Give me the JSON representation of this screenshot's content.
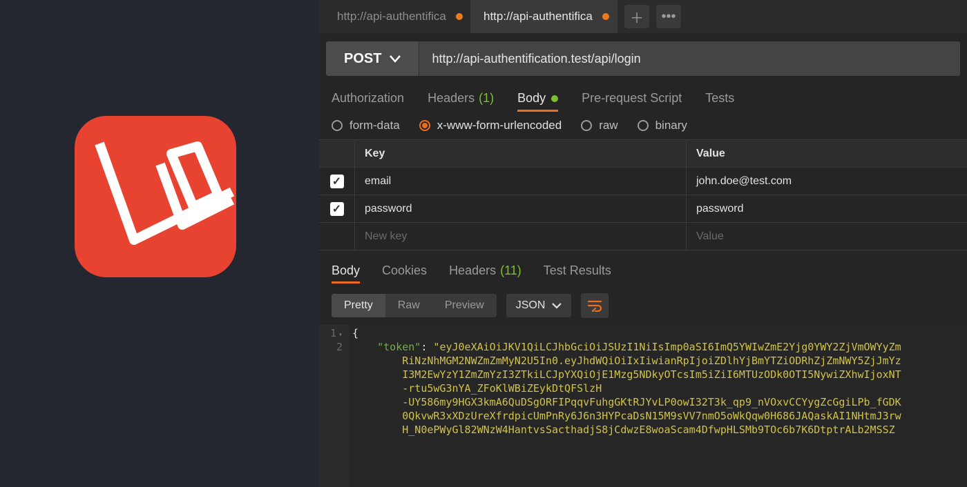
{
  "tabs": [
    {
      "label": "http://api-authentifica",
      "dirty": true,
      "active": false
    },
    {
      "label": "http://api-authentifica",
      "dirty": true,
      "active": true
    }
  ],
  "request": {
    "method": "POST",
    "url": "http://api-authentification.test/api/login"
  },
  "request_tabs": {
    "authorization": "Authorization",
    "headers": {
      "label": "Headers",
      "count": "(1)"
    },
    "body": "Body",
    "pre_request": "Pre-request Script",
    "tests": "Tests"
  },
  "body_types": {
    "form_data": "form-data",
    "urlencoded": "x-www-form-urlencoded",
    "raw": "raw",
    "binary": "binary"
  },
  "table": {
    "key_header": "Key",
    "value_header": "Value",
    "rows": [
      {
        "key": "email",
        "value": "john.doe@test.com"
      },
      {
        "key": "password",
        "value": "password"
      }
    ],
    "new_key_placeholder": "New key",
    "new_value_placeholder": "Value"
  },
  "response_tabs": {
    "body": "Body",
    "cookies": "Cookies",
    "headers": {
      "label": "Headers",
      "count": "(11)"
    },
    "test_results": "Test Results"
  },
  "response_view": {
    "pretty": "Pretty",
    "raw": "Raw",
    "preview": "Preview",
    "format": "JSON"
  },
  "response_body": {
    "line1_open": "{",
    "line2_key": "\"token\"",
    "line2_colon": ": ",
    "line2_val_open": "\"",
    "token_chunks": [
      "eyJ0eXAiOiJKV1QiLCJhbGciOiJSUzI1NiIsImp0aSI6ImQ5YWIwZmE2Yjg0YWY2ZjVmOWYyZm",
      "RiNzNhMGM2NWZmZmMyN2U5In0.eyJhdWQiOiIxIiwianRpIjoiZDlhYjBmYTZiODRhZjZmNWY5ZjJmYz",
      "I3M2EwYzY1ZmZmYzI3ZTkiLCJpYXQiOjE1Mzg5NDkyOTcsIm5iZiI6MTUzODk0OTI5NywiZXhwIjoxNT",
      "-rtu5wG3nYA_ZFoKlWBiZEykDtQFSlzH",
      "-UY586my9HGX3kmA6QuDSgORFIPqqvFuhgGKtRJYvLP0owI32T3k_qp9_nVOxvCCYygZcGgiLPb_fGDK",
      "0QkvwR3xXDzUreXfrdpicUmPnRy6J6n3HYPcaDsN15M9sVV7nmO5oWkQqw0H686JAQaskAI1NHtmJ3rw",
      "H_N0ePWyGl82WNzW4HantvsSacthadjS8jCdwzE8woaScam4DfwpHLSMb9TOc6b7K6DtptrALb2MSSZ"
    ]
  }
}
